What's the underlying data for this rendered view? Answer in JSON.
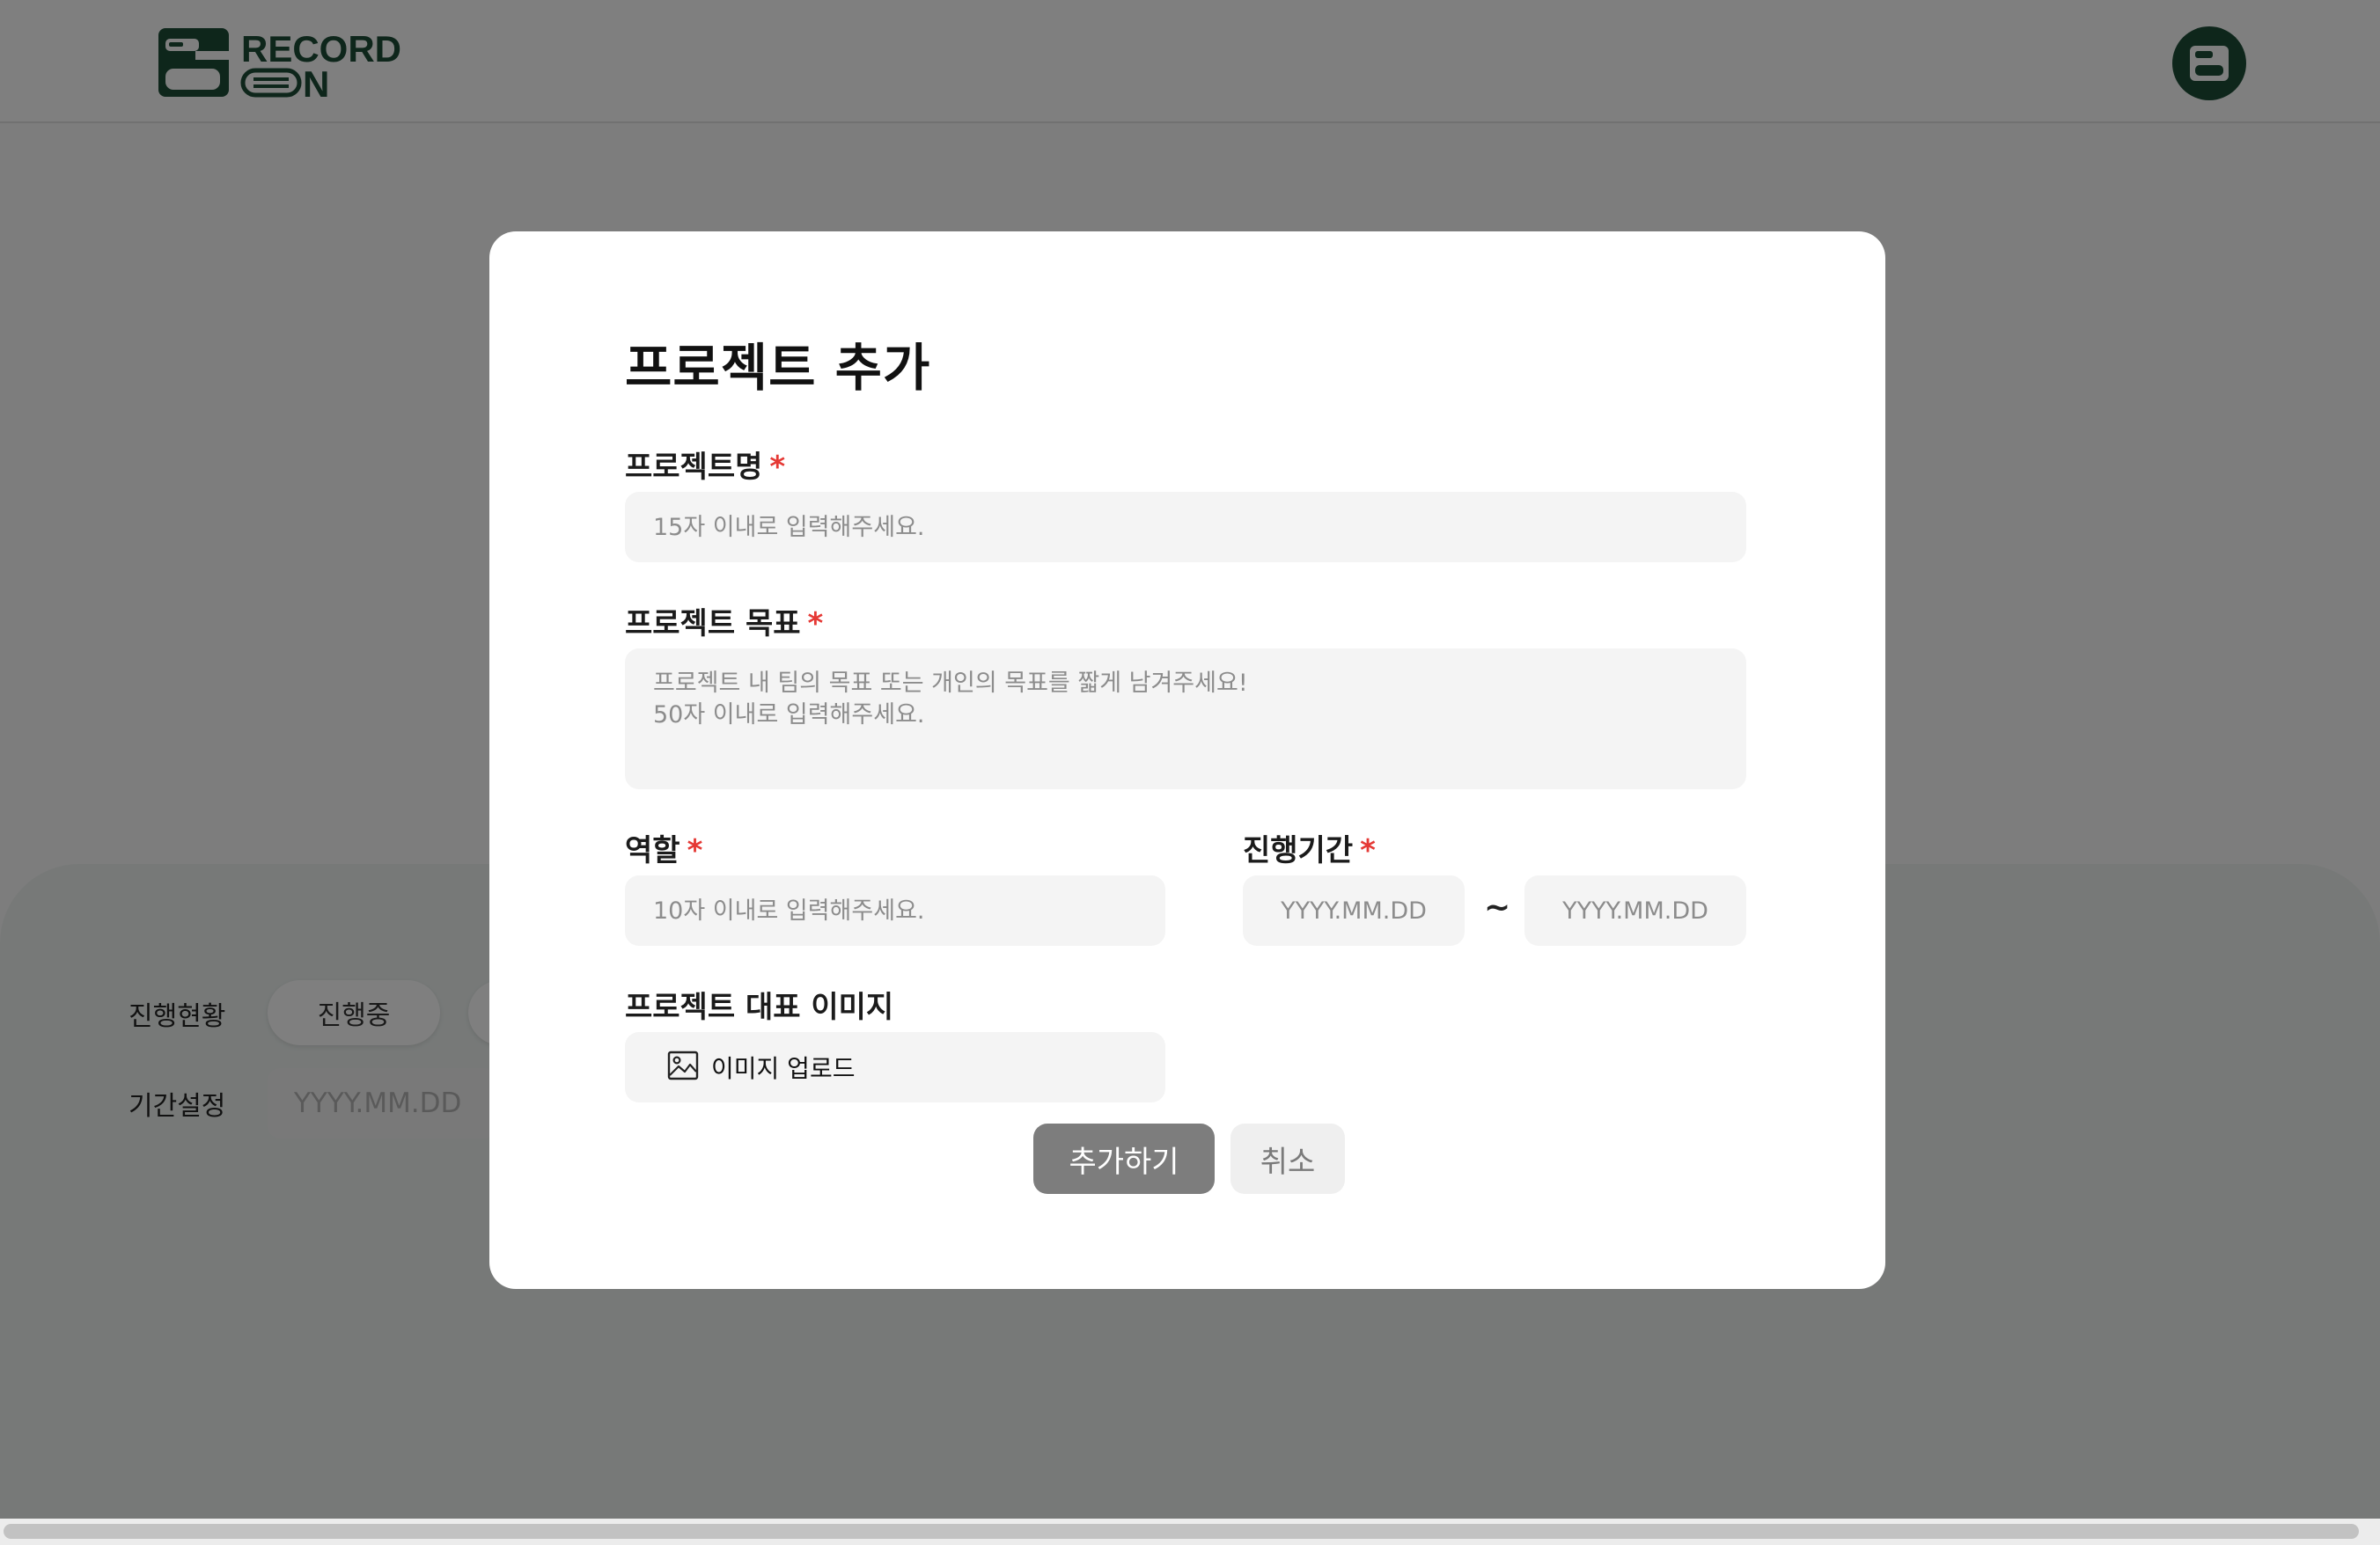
{
  "header": {
    "logo_text_line1": "RECORD",
    "logo_text_line2": "N"
  },
  "background": {
    "status_label": "진행현황",
    "status_chip": "진행중",
    "period_label": "기간설정",
    "period_placeholder": "YYYY.MM.DD"
  },
  "modal": {
    "title": "프로젝트 추가",
    "required_mark": "*",
    "project_name": {
      "label": "프로젝트명",
      "placeholder": "15자 이내로 입력해주세요."
    },
    "project_goal": {
      "label": "프로젝트 목표",
      "placeholder": "프로젝트 내 팀의 목표 또는 개인의 목표를 짧게 남겨주세요!\n50자 이내로 입력해주세요."
    },
    "role": {
      "label": "역할",
      "placeholder": "10자 이내로 입력해주세요."
    },
    "period": {
      "label": "진행기간",
      "start_placeholder": "YYYY.MM.DD",
      "separator": "~",
      "end_placeholder": "YYYY.MM.DD"
    },
    "image": {
      "label": "프로젝트 대표 이미지",
      "upload_label": "이미지 업로드"
    },
    "buttons": {
      "add": "추가하기",
      "cancel": "취소"
    }
  },
  "colors": {
    "brand": "#1c4d37",
    "required": "#e53935",
    "add_button": "#7d7d7d",
    "field_bg": "#f4f4f4"
  },
  "icons": {
    "upload": "image-icon",
    "profile": "profile-avatar-icon"
  }
}
